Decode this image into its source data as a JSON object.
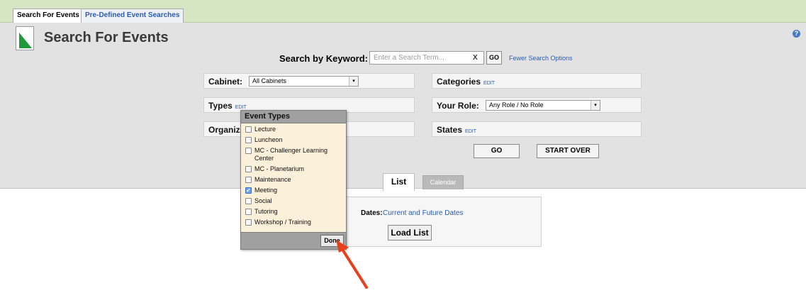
{
  "tabs": [
    {
      "label": "Search For Events"
    },
    {
      "label": "Pre-Defined Event Searches"
    }
  ],
  "header": {
    "title": "Search For Events",
    "help_glyph": "?"
  },
  "keyword": {
    "label": "Search by Keyword:",
    "placeholder": "Enter a Search Term...",
    "clear_label": "X",
    "go_label": "GO",
    "fewer_options": "Fewer Search Options"
  },
  "fields": {
    "cabinet": {
      "label": "Cabinet:",
      "value": "All Cabinets"
    },
    "categories": {
      "label": "Categories",
      "edit": "EDIT"
    },
    "types": {
      "label": "Types",
      "edit": "EDIT"
    },
    "role": {
      "label": "Your Role:",
      "value": "Any Role / No Role"
    },
    "organiz": {
      "label": "Organiz"
    },
    "states": {
      "label": "States",
      "edit": "EDIT"
    }
  },
  "actions": {
    "go": "GO",
    "start_over": "START OVER"
  },
  "view_tabs": {
    "list": "List",
    "calendar": "Calendar"
  },
  "list_panel": {
    "dates_label": "Dates:",
    "dates_value": "Current and Future Dates",
    "load_list": "Load List"
  },
  "event_types_popup": {
    "title": "Event Types",
    "options": [
      {
        "label": "Lecture",
        "checked": false
      },
      {
        "label": "Luncheon",
        "checked": false
      },
      {
        "label": "MC - Challenger Learning Center",
        "checked": false
      },
      {
        "label": "MC - Planetarium",
        "checked": false
      },
      {
        "label": "Maintenance",
        "checked": false
      },
      {
        "label": "Meeting",
        "checked": true
      },
      {
        "label": "Social",
        "checked": false
      },
      {
        "label": "Tutoring",
        "checked": false
      },
      {
        "label": "Workshop / Training",
        "checked": false
      }
    ],
    "done_label": "Done"
  },
  "colors": {
    "tabstrip_bg": "#d6e5c4",
    "panel_bg": "#e2e2e2",
    "popup_bg": "#fbf0d9",
    "link": "#2a5db0",
    "annotation_arrow": "#e8401c"
  }
}
